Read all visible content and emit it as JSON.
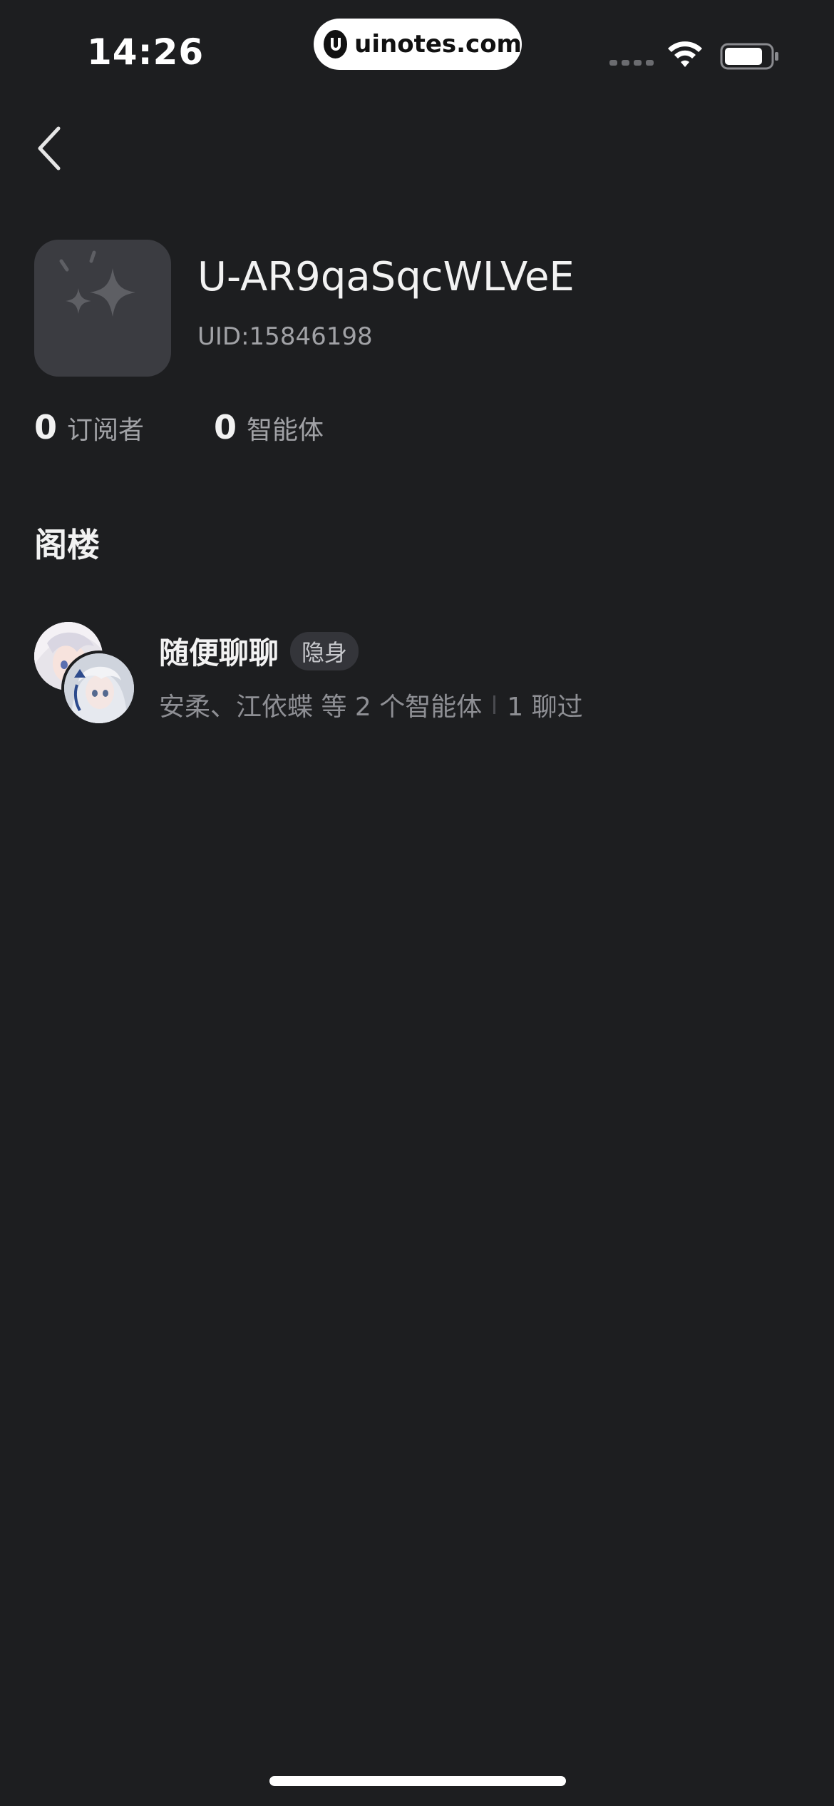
{
  "status_bar": {
    "time": "14:26",
    "watermark": "uinotes.com",
    "icons": [
      "signal-icon",
      "wifi-icon",
      "battery-icon"
    ]
  },
  "nav": {
    "back_icon": "chevron-left-icon"
  },
  "profile": {
    "username": "U-AR9qaSqcWLVeE",
    "uid": "UID:15846198",
    "avatar_icon": "sparkle-icon"
  },
  "stats": [
    {
      "value": "0",
      "label": "订阅者"
    },
    {
      "value": "0",
      "label": "智能体"
    }
  ],
  "section": {
    "title": "阁楼"
  },
  "attic_items": [
    {
      "title": "随便聊聊",
      "badge": "隐身",
      "members": "安柔、江依蝶 等 2 个智能体",
      "chats": "1 聊过"
    }
  ],
  "colors": {
    "background": "#1d1e20",
    "text_primary": "#f2f2f2",
    "text_secondary": "#a1a2a6",
    "badge_bg": "#34353a"
  }
}
